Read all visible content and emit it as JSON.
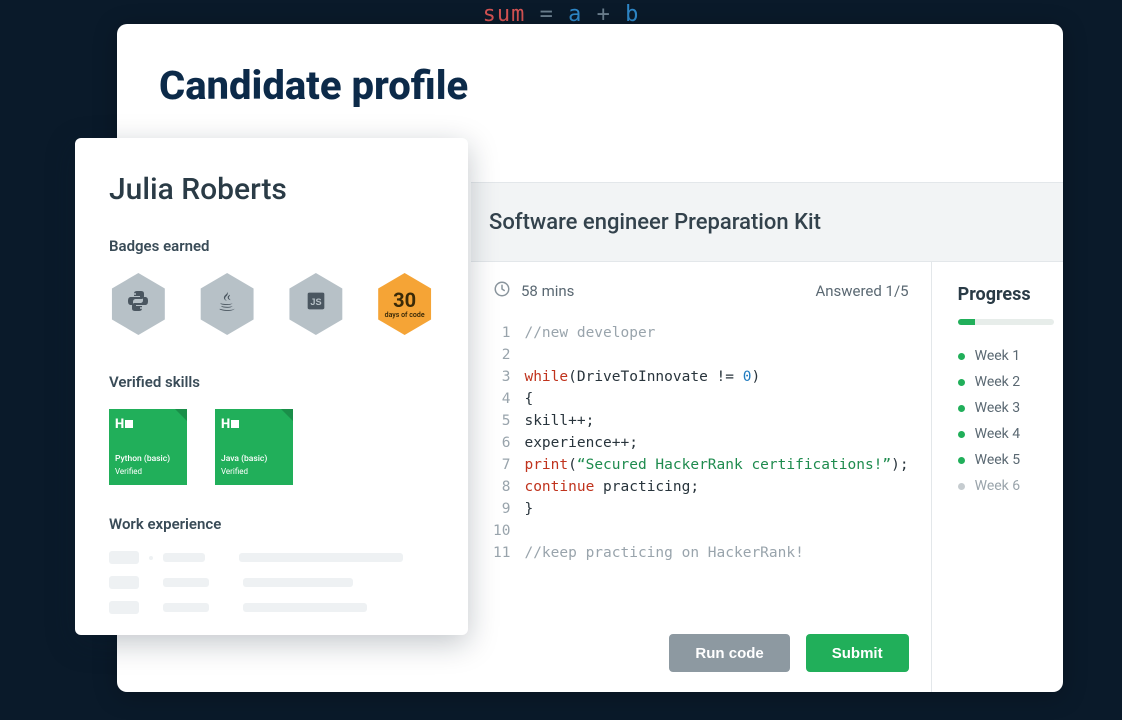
{
  "bg_code": {
    "a": "sum",
    "eq": " = ",
    "b": "a",
    "plus": " + ",
    "c": "b"
  },
  "page": {
    "title": "Candidate profile"
  },
  "profile": {
    "name": "Julia Roberts",
    "badges_label": "Badges earned",
    "badges": [
      {
        "id": "python-badge",
        "kind": "icon",
        "glyph": "python"
      },
      {
        "id": "java-badge",
        "kind": "icon",
        "glyph": "java"
      },
      {
        "id": "js-badge",
        "kind": "icon",
        "glyph": "js"
      },
      {
        "id": "days-of-code-badge",
        "kind": "number",
        "number": "30",
        "sub": "days of code"
      }
    ],
    "skills_label": "Verified skills",
    "skills": [
      {
        "id": "python-basic",
        "logo": "H",
        "name": "Python (basic)",
        "status": "Verified"
      },
      {
        "id": "java-basic",
        "logo": "H",
        "name": "Java (basic)",
        "status": "Verified"
      }
    ],
    "work_label": "Work experience"
  },
  "kit": {
    "title": "Software engineer Preparation Kit",
    "time": "58 mins",
    "answered": "Answered 1/5",
    "code_lines": [
      {
        "n": 1,
        "segments": [
          {
            "cls": "cmt",
            "t": "//new developer"
          }
        ]
      },
      {
        "n": 2,
        "segments": [
          {
            "cls": "",
            "t": ""
          }
        ]
      },
      {
        "n": 3,
        "segments": [
          {
            "cls": "kw",
            "t": "while"
          },
          {
            "cls": "op",
            "t": "(DriveToInnovate != "
          },
          {
            "cls": "num",
            "t": "0"
          },
          {
            "cls": "op",
            "t": ")"
          }
        ]
      },
      {
        "n": 4,
        "segments": [
          {
            "cls": "op",
            "t": "{"
          }
        ]
      },
      {
        "n": 5,
        "segments": [
          {
            "cls": "op",
            "t": "skill++;"
          }
        ]
      },
      {
        "n": 6,
        "segments": [
          {
            "cls": "op",
            "t": "experience++;"
          }
        ]
      },
      {
        "n": 7,
        "segments": [
          {
            "cls": "fn",
            "t": "print"
          },
          {
            "cls": "op",
            "t": "("
          },
          {
            "cls": "str",
            "t": "“Secured HackerRank certifications!”"
          },
          {
            "cls": "op",
            "t": ");"
          }
        ]
      },
      {
        "n": 8,
        "segments": [
          {
            "cls": "kw",
            "t": "continue"
          },
          {
            "cls": "op",
            "t": " practicing;"
          }
        ]
      },
      {
        "n": 9,
        "segments": [
          {
            "cls": "op",
            "t": "}"
          }
        ]
      },
      {
        "n": 10,
        "segments": [
          {
            "cls": "",
            "t": ""
          }
        ]
      },
      {
        "n": 11,
        "segments": [
          {
            "cls": "cmt",
            "t": "//keep practicing on HackerRank!"
          }
        ]
      }
    ],
    "actions": {
      "run": "Run code",
      "submit": "Submit"
    },
    "progress": {
      "title": "Progress",
      "percent": 18,
      "weeks": [
        {
          "label": "Week 1",
          "done": true
        },
        {
          "label": "Week 2",
          "done": true
        },
        {
          "label": "Week 3",
          "done": true
        },
        {
          "label": "Week 4",
          "done": true
        },
        {
          "label": "Week 5",
          "done": true
        },
        {
          "label": "Week 6",
          "done": false
        }
      ]
    }
  }
}
